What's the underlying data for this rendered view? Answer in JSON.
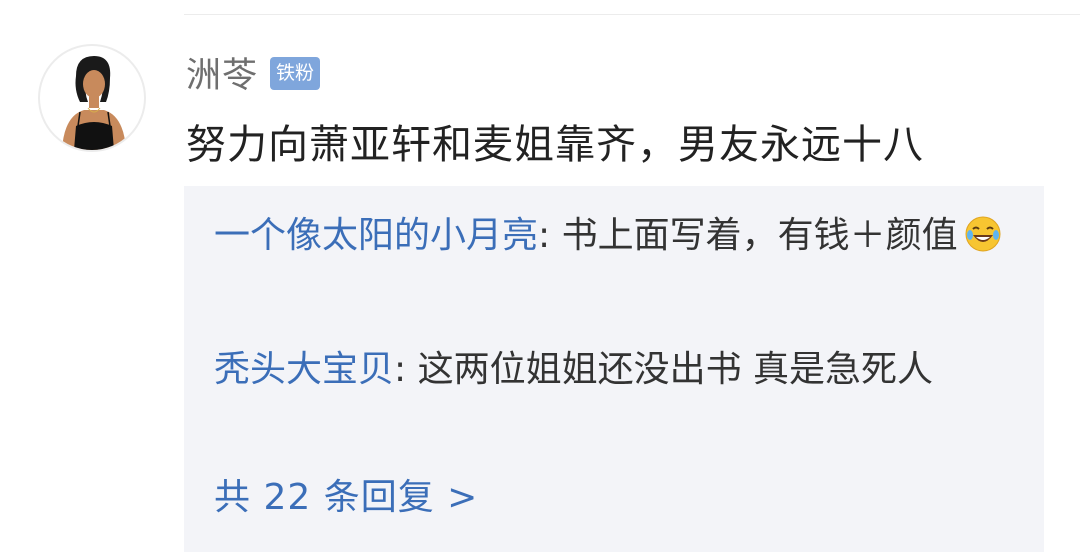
{
  "comment": {
    "username": "洲苓",
    "badge": "铁粉",
    "text": "努力向萧亚轩和麦姐靠齐，男友永远十八"
  },
  "replies": [
    {
      "author": "一个像太阳的小月亮",
      "separator": ": ",
      "text": "书上面写着，有钱＋颜值",
      "emoji": "laughing-crying-emoji"
    },
    {
      "author": "秃头大宝贝",
      "separator": ": ",
      "text": "这两位姐姐还没出书  真是急死人"
    }
  ],
  "view_more": {
    "label": "共 22 条回复 >"
  },
  "colors": {
    "link_blue": "#3b6eb8",
    "badge_blue": "#7fa6dc",
    "reply_bg": "#f3f4f8"
  }
}
